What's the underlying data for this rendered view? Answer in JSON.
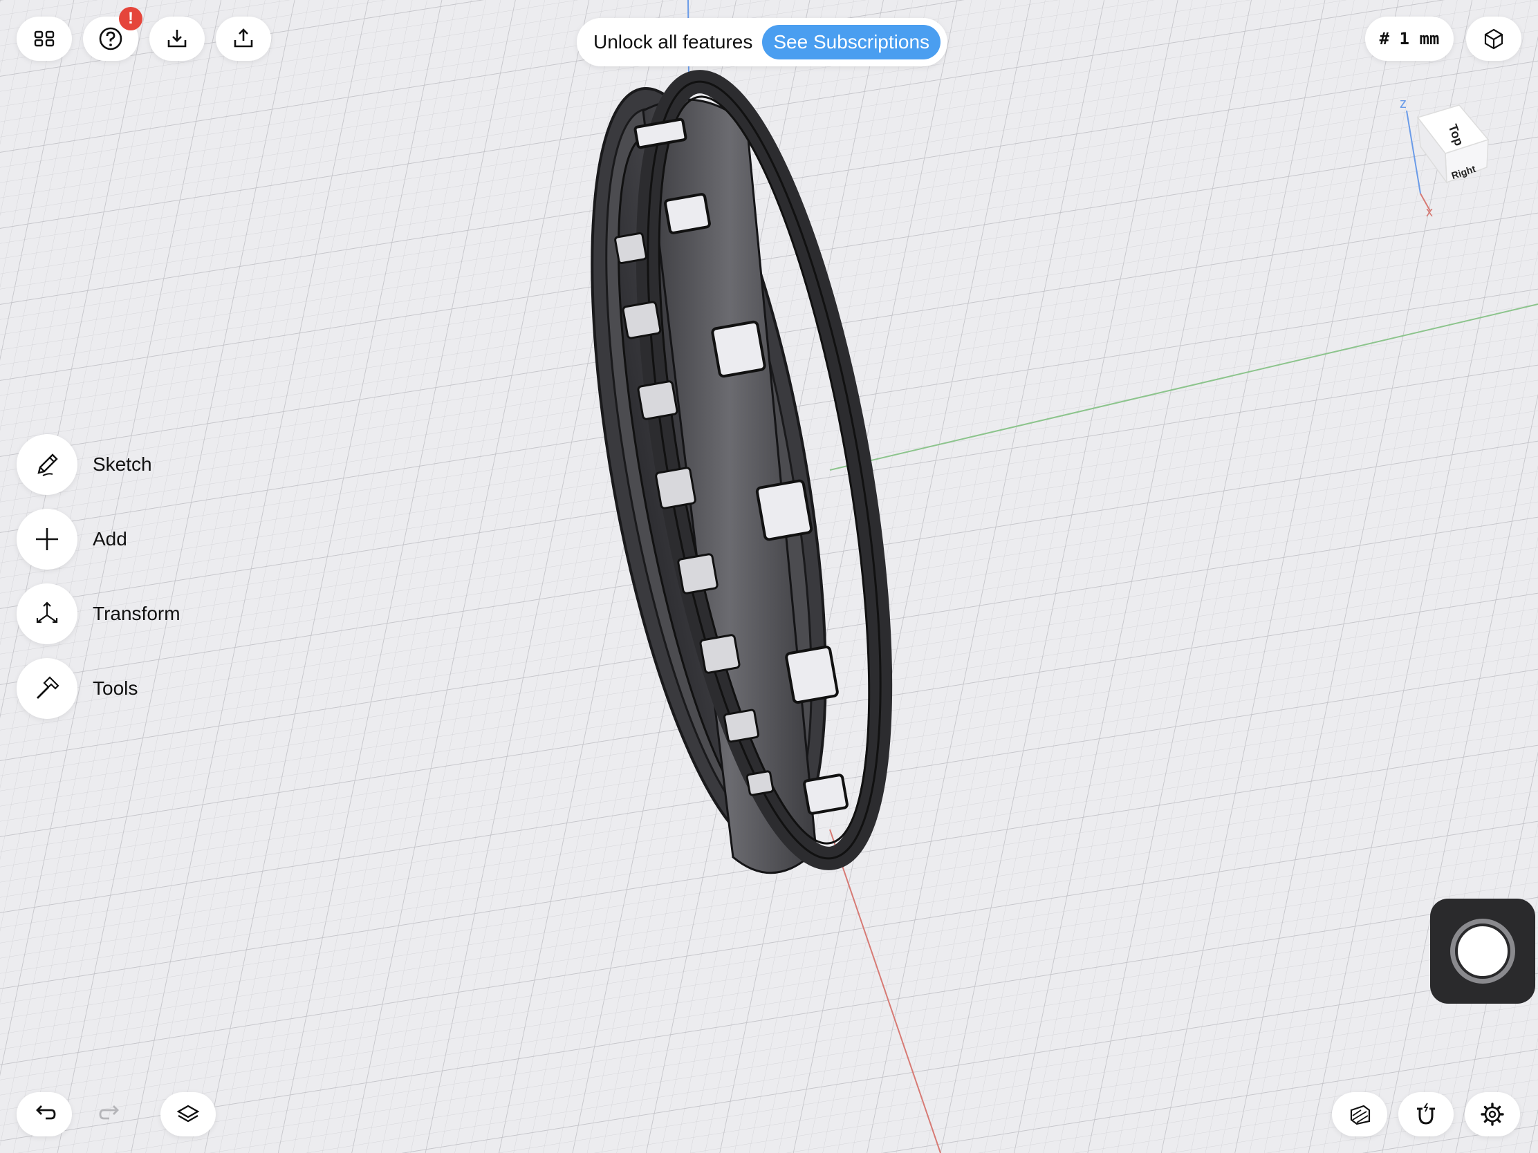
{
  "toolbar": {
    "grid_menu_icon": "grid-four-squares",
    "help_icon": "question-circle",
    "help_badge": "!",
    "import_icon": "tray-arrow-down",
    "export_icon": "tray-arrow-up"
  },
  "promo": {
    "text": "Unlock all features",
    "button": "See Subscriptions"
  },
  "grid_size": {
    "label": "# 1 mm"
  },
  "view_cube": {
    "top": "Top",
    "right": "Right",
    "axis_z": "z",
    "axis_x": "x"
  },
  "side_menu": [
    {
      "label": "Sketch",
      "icon": "pencil-icon"
    },
    {
      "label": "Add",
      "icon": "plus-icon"
    },
    {
      "label": "Transform",
      "icon": "move-arrows-icon"
    },
    {
      "label": "Tools",
      "icon": "hammer-icon"
    }
  ],
  "bottom_bar": {
    "undo_icon": "undo-arrow",
    "redo_icon": "redo-arrow",
    "layers_icon": "layers",
    "section_icon": "section-view",
    "snap_icon": "magnet",
    "settings_icon": "gear"
  },
  "colors": {
    "accent": "#4a9ef0",
    "badge": "#e5453b",
    "axis_x": "#d9534f",
    "axis_y": "#5cb85c",
    "axis_z": "#4a86e8",
    "model": "#4a4a4e"
  }
}
